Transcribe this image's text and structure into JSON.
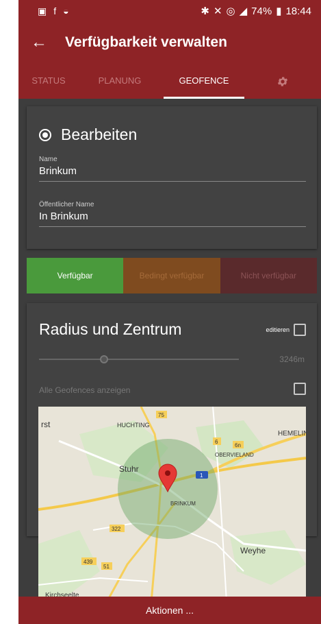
{
  "status_bar": {
    "battery": "74%",
    "time": "18:44"
  },
  "toolbar": {
    "back_icon": "arrow-left-icon",
    "title": "Verfügbarkeit verwalten"
  },
  "tabs": [
    {
      "label": "STATUS"
    },
    {
      "label": "PLANUNG"
    },
    {
      "label": "GEOFENCE",
      "active": true
    }
  ],
  "settings_icon": "gear-icon",
  "edit_card": {
    "heading": "Bearbeiten",
    "name_label": "Name",
    "name_value": "Brinkum",
    "public_name_label": "Öffentlicher Name",
    "public_name_value": "In Brinkum"
  },
  "availability": [
    {
      "label": "Verfügbar",
      "selected": true
    },
    {
      "label": "Bedingt verfügbar",
      "selected": false
    },
    {
      "label": "Nicht verfügbar",
      "selected": false
    }
  ],
  "radius_card": {
    "heading": "Radius und Zentrum",
    "edit_label": "editieren",
    "radius_value": "3246m",
    "show_all_label": "Alle Geofences anzeigen"
  },
  "map": {
    "labels": {
      "huchting": "HUCHTING",
      "hemelin": "HEMELIN",
      "obervieland": "OBERVIELAND",
      "stuhr": "Stuhr",
      "brinkum": "BRINKUM",
      "weyhe": "Weyhe",
      "kirchseelte": "Kirchseelte",
      "rst": "rst"
    },
    "roads": {
      "r75": "75",
      "r6": "6",
      "r6n": "6n",
      "r1": "1",
      "r322": "322",
      "r439": "439",
      "r51": "51"
    }
  },
  "bottom": {
    "actions_label": "Aktionen ..."
  },
  "colors": {
    "primary": "#8e2326",
    "card": "#424242",
    "available": "#4a9a3c"
  }
}
